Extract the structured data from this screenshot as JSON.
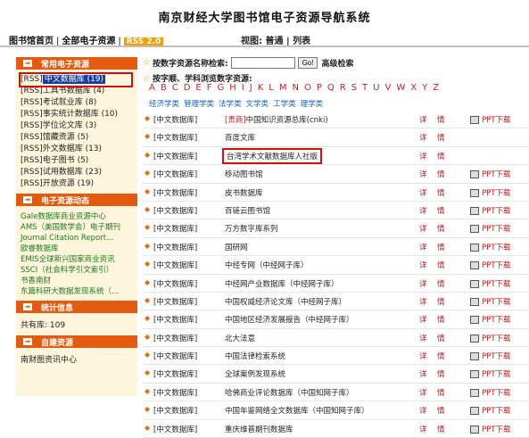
{
  "title": "南京财经大学图书馆电子资源导航系统",
  "topnav": {
    "home": "图书馆首页",
    "all": "全部电子资源",
    "rss": "RSS 2.0",
    "view_label": "视图:",
    "view_normal": "普通",
    "view_list": "列表"
  },
  "sidebar": {
    "common_title": "常用电子资源",
    "common_items": [
      {
        "rss": "[RSS]",
        "label": "中文数据库 (19)"
      },
      {
        "rss": "[RSS]",
        "label": "工具书数据库 (4)"
      },
      {
        "rss": "[RSS]",
        "label": "考试就业库 (8)"
      },
      {
        "rss": "[RSS]",
        "label": "事实统计数据库 (10)"
      },
      {
        "rss": "[RSS]",
        "label": "学位论文库 (3)"
      },
      {
        "rss": "[RSS]",
        "label": "馆藏资源 (5)"
      },
      {
        "rss": "[RSS]",
        "label": "外文数据库 (13)"
      },
      {
        "rss": "[RSS]",
        "label": "电子图书 (5)"
      },
      {
        "rss": "[RSS]",
        "label": "试用数据库 (23)"
      },
      {
        "rss": "[RSS]",
        "label": "开放资源 (19)"
      }
    ],
    "dyn_title": "电子资源动态",
    "dyn_items": [
      "Gale数据库商业资源中心",
      "AMS（美国数学会）电子期刊",
      "Journal Citation Report...",
      "欧睿数据库",
      "EMIS全球新兴国家商业资讯",
      "SSCI（社会科学引文索引）",
      "书香南财",
      "东篇科研大数据发现系统（..."
    ],
    "stats_title": "统计信息",
    "stats_text": "共有库: 109",
    "custom_title": "自建资源",
    "custom_item": "南财图资讯中心"
  },
  "main": {
    "search_label": "按数字资源名称检索:",
    "go": "Go!",
    "advanced": "高级检索",
    "nav_label": "按字顺、学科浏览数字资源:",
    "letters": [
      "A",
      "B",
      "C",
      "D",
      "E",
      "F",
      "G",
      "H",
      "I",
      "J",
      "K",
      "L",
      "M",
      "N",
      "O",
      "P",
      "Q",
      "R",
      "S",
      "T",
      "U",
      "V",
      "W",
      "X",
      "Y",
      "Z"
    ],
    "categories": [
      "经济学类",
      "管理学类",
      "法学类",
      "文学类",
      "工学类",
      "理学类"
    ],
    "detail": "详",
    "intro": "情",
    "ppt": "PPT下载",
    "rows": [
      {
        "cat": "[中文数据库]",
        "paid": "[责商]",
        "name": "中国知识资源总库(cnki)",
        "ppt": true
      },
      {
        "cat": "[中文数据库]",
        "paid": "",
        "name": "百度文库",
        "ppt": false
      },
      {
        "cat": "[中文数据库]",
        "paid": "",
        "name": "台湾学术文献数据库人社版",
        "ppt": false
      },
      {
        "cat": "[中文数据库]",
        "paid": "",
        "name": "移动图书馆",
        "ppt": true
      },
      {
        "cat": "[中文数据库]",
        "paid": "",
        "name": "皮书数据库",
        "ppt": true
      },
      {
        "cat": "[中文数据库]",
        "paid": "",
        "name": "百链云图书馆",
        "ppt": true
      },
      {
        "cat": "[中文数据库]",
        "paid": "",
        "name": "万方数字库系列",
        "ppt": true
      },
      {
        "cat": "[中文数据库]",
        "paid": "",
        "name": "国研网",
        "ppt": true
      },
      {
        "cat": "[中文数据库]",
        "paid": "",
        "name": "中经专网（中经网子库）",
        "ppt": true
      },
      {
        "cat": "[中文数据库]",
        "paid": "",
        "name": "中经网产业数据库（中经网子库）",
        "ppt": true
      },
      {
        "cat": "[中文数据库]",
        "paid": "",
        "name": "中国权威经济论文库（中经网子库）",
        "ppt": true
      },
      {
        "cat": "[中文数据库]",
        "paid": "",
        "name": "中国地区经济发展报告（中经网子库）",
        "ppt": true
      },
      {
        "cat": "[中文数据库]",
        "paid": "",
        "name": "北大法意",
        "ppt": true
      },
      {
        "cat": "[中文数据库]",
        "paid": "",
        "name": "中国法律检索系统",
        "ppt": true
      },
      {
        "cat": "[中文数据库]",
        "paid": "",
        "name": "全球案例发现系统",
        "ppt": true
      },
      {
        "cat": "[中文数据库]",
        "paid": "",
        "name": "哈佛商业评论数据库（中国知网子库）",
        "ppt": true
      },
      {
        "cat": "[中文数据库]",
        "paid": "",
        "name": "中国年鉴网络全文数据库（中国知网子库）",
        "ppt": true
      },
      {
        "cat": "[中文数据库]",
        "paid": "",
        "name": "重庆维普期刊数据库",
        "ppt": true
      }
    ]
  }
}
